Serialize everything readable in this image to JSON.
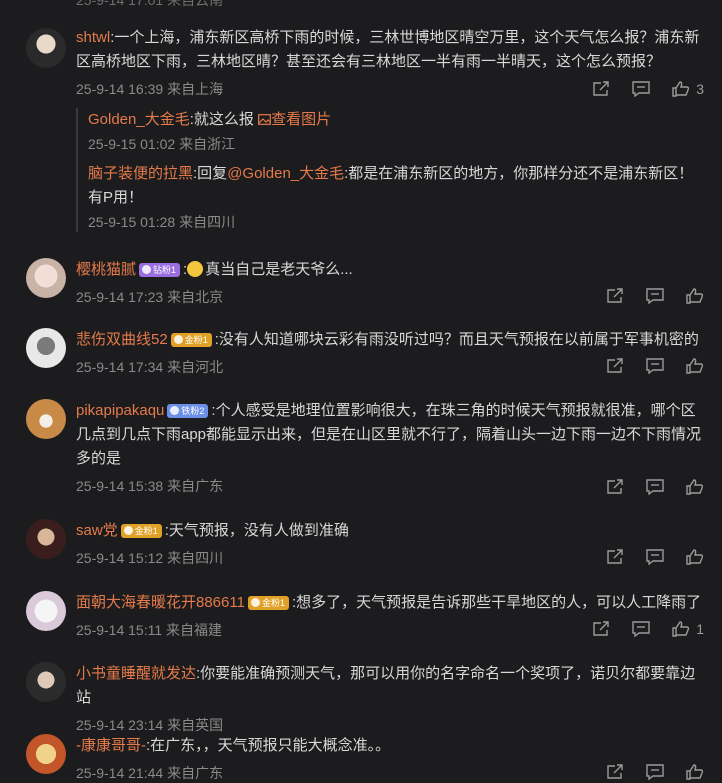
{
  "top_cut": "25-9-14 17:01 来自云南",
  "comments": [
    {
      "user": "shtwl",
      "text": ":一个上海，浦东新区高桥下雨的时候，三林世博地区晴空万里，这个天气怎么报？浦东新区高桥地区下雨，三林地区晴？甚至还会有三林地区一半有雨一半晴天，这个怎么预报？",
      "meta": "25-9-14 16:39 来自上海",
      "likes": "3",
      "replies": [
        {
          "user": "Golden_大金毛",
          "text": ":就这么报",
          "link": "查看图片",
          "meta": "25-9-15 01:02 来自浙江"
        },
        {
          "user": "脑子装便的拉黑",
          "prefix": ":回复",
          "mention": "@Golden_大金毛",
          "text": ":都是在浦东新区的地方，你那样分还不是浦东新区！有P用！",
          "meta": "25-9-15 01:28 来自四川"
        }
      ]
    },
    {
      "user": "樱桃猫腻",
      "badge": "钻粉1",
      "text": "真当自己是老天爷么...",
      "meta": "25-9-14 17:23 来自北京",
      "likes": ""
    },
    {
      "user": "悲伤双曲线52",
      "badge": "金粉1",
      "text": ":没有人知道哪块云彩有雨没听过吗？而且天气预报在以前属于军事机密的",
      "meta": "25-9-14 17:34 来自河北",
      "likes": ""
    },
    {
      "user": "pikapipakaqu",
      "badge": "铁粉2",
      "text": ":个人感受是地理位置影响很大，在珠三角的时候天气预报就很准，哪个区几点到几点下雨app都能显示出来，但是在山区里就不行了，隔着山头一边下雨一边不下雨情况多的是",
      "meta": "25-9-14 15:38 来自广东",
      "likes": ""
    },
    {
      "user": "saw党",
      "badge": "金粉1",
      "text": ":天气预报，没有人做到准确",
      "meta": "25-9-14 15:12 来自四川",
      "likes": ""
    },
    {
      "user": "面朝大海春暖花开886611",
      "badge": "金粉1",
      "text": ":想多了，天气预报是告诉那些干旱地区的人，可以人工降雨了",
      "meta": "25-9-14 15:11 来自福建",
      "likes": "1"
    },
    {
      "user": "小书童睡醒就发达",
      "text": ":你要能准确预测天气，那可以用你的名字命名一个奖项了，诺贝尔都要靠边站",
      "meta": "25-9-14 23:14 来自英国",
      "likes": ""
    },
    {
      "user": "-康康哥哥-",
      "text": ":在广东，，天气预报只能大概念准。。",
      "meta": "25-9-14 21:44 来自广东",
      "likes": ""
    }
  ],
  "colors": {
    "username": "#e57a4a",
    "background": "#1c1c1e",
    "meta": "#8a8a8a"
  },
  "icons": [
    "share-icon",
    "comment-icon",
    "like-icon"
  ]
}
